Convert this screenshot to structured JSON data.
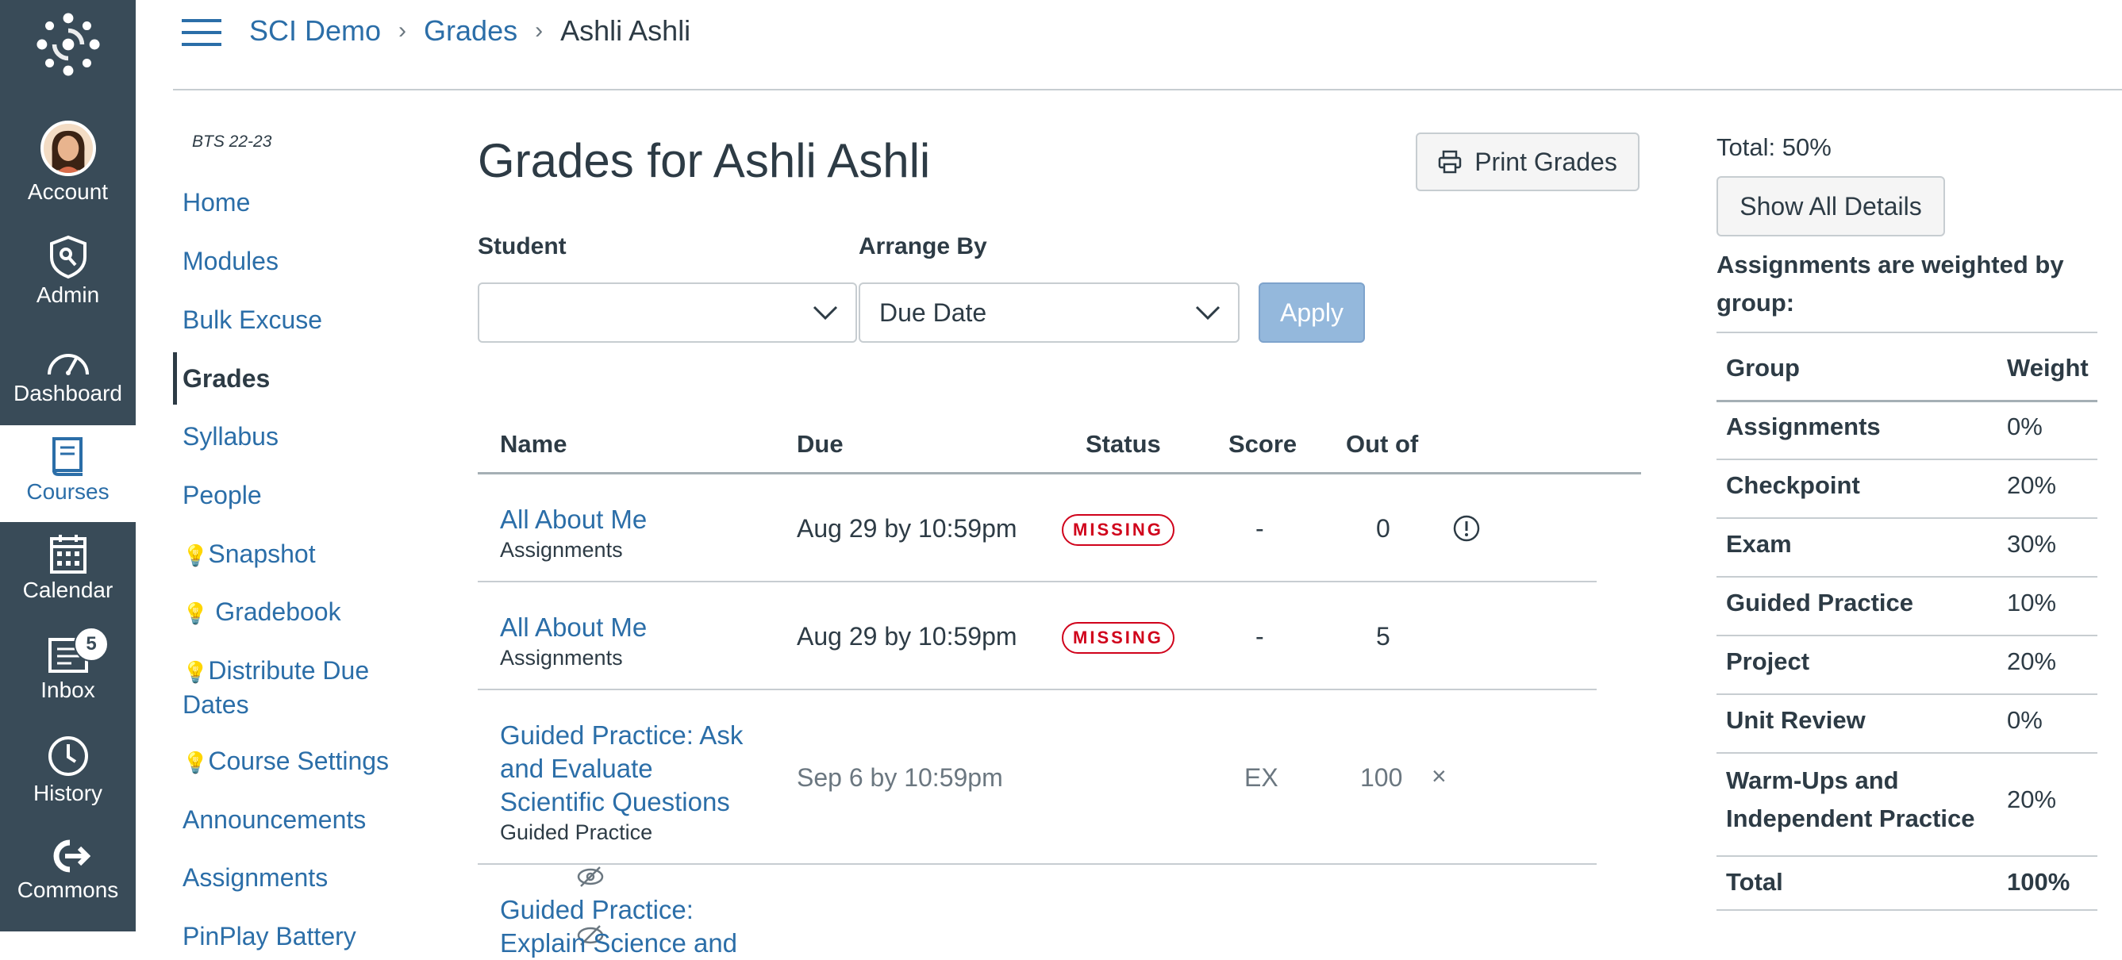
{
  "global_nav": {
    "items": [
      {
        "label": "Account",
        "icon": "avatar"
      },
      {
        "label": "Admin",
        "icon": "admin-shield-icon"
      },
      {
        "label": "Dashboard",
        "icon": "dashboard-gauge-icon"
      },
      {
        "label": "Courses",
        "icon": "courses-book-icon",
        "active": true
      },
      {
        "label": "Calendar",
        "icon": "calendar-icon"
      },
      {
        "label": "Inbox",
        "icon": "inbox-icon",
        "badge": "5"
      },
      {
        "label": "History",
        "icon": "history-clock-icon"
      },
      {
        "label": "Commons",
        "icon": "commons-icon"
      }
    ]
  },
  "breadcrumb": {
    "items": [
      "SCI Demo",
      "Grades",
      "Ashli Ashli"
    ],
    "separator": "›"
  },
  "course_nav": {
    "term": "BTS 22-23",
    "items": [
      {
        "label": "Home"
      },
      {
        "label": "Modules"
      },
      {
        "label": "Bulk Excuse"
      },
      {
        "label": "Grades",
        "active": true
      },
      {
        "label": "Syllabus"
      },
      {
        "label": "People"
      },
      {
        "label": "Snapshot",
        "bulb": true
      },
      {
        "label": "Gradebook",
        "bulb": true
      },
      {
        "label": "Distribute Due Dates",
        "bulb": true
      },
      {
        "label": "Course Settings",
        "bulb": true
      },
      {
        "label": "Announcements"
      },
      {
        "label": "Assignments",
        "hidden": true
      },
      {
        "label": "PinPlay Battery",
        "hidden": true
      }
    ]
  },
  "main": {
    "title": "Grades for Ashli Ashli",
    "print_button": "Print Grades",
    "filters": {
      "student_label": "Student",
      "student_value": "",
      "arrange_label": "Arrange By",
      "arrange_value": "Due Date",
      "apply_button": "Apply"
    },
    "table": {
      "headers": [
        "Name",
        "Due",
        "Status",
        "Score",
        "Out of"
      ],
      "rows": [
        {
          "name": "All About Me",
          "group": "Assignments",
          "due": "Aug 29 by 10:59pm",
          "status": "MISSING",
          "score": "-",
          "out_of": "0",
          "icon": "alert-circle-icon"
        },
        {
          "name": "All About Me",
          "group": "Assignments",
          "due": "Aug 29 by 10:59pm",
          "status": "MISSING",
          "score": "-",
          "out_of": "5"
        },
        {
          "name": "Guided Practice: Ask and Evaluate Scientific Questions",
          "group": "Guided Practice",
          "due": "Sep 6 by 10:59pm",
          "status": "",
          "score": "EX",
          "out_of": "100",
          "mark": "×"
        },
        {
          "name": "Guided Practice: Explain Science and",
          "group": "",
          "due": "",
          "status": "",
          "score": "",
          "out_of": ""
        }
      ]
    }
  },
  "sidebar": {
    "total": "Total: 50%",
    "show_details_button": "Show All Details",
    "weight_note": "Assignments are weighted by group:",
    "weights": {
      "headers": [
        "Group",
        "Weight"
      ],
      "rows": [
        {
          "group": "Assignments",
          "weight": "0%"
        },
        {
          "group": "Checkpoint",
          "weight": "20%"
        },
        {
          "group": "Exam",
          "weight": "30%"
        },
        {
          "group": "Guided Practice",
          "weight": "10%"
        },
        {
          "group": "Project",
          "weight": "20%"
        },
        {
          "group": "Unit Review",
          "weight": "0%"
        },
        {
          "group": "Warm-Ups and Independent Practice",
          "weight": "20%"
        },
        {
          "group": "Total",
          "weight": "100%"
        }
      ]
    }
  },
  "colors": {
    "nav_bg": "#394b58",
    "link": "#2b6ea8",
    "missing": "#d0021b",
    "apply_disabled": "#94b8dc"
  }
}
